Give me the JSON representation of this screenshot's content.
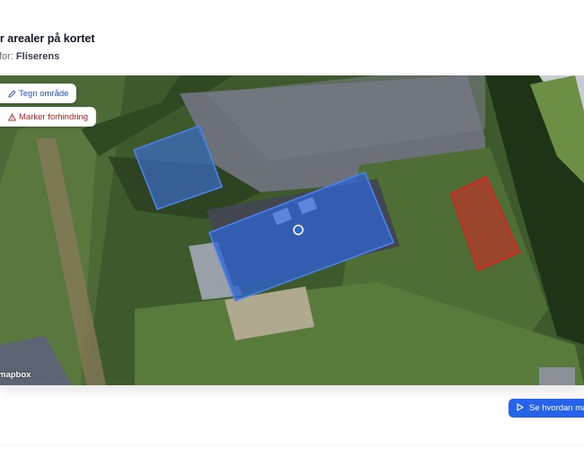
{
  "header": {
    "title": "ker arealer på kortet",
    "subtitle_prefix": "her for:",
    "service_name": "Fliserens"
  },
  "map": {
    "draw_area_label": "Tegn område",
    "mark_obstacle_label": "Marker forhindring",
    "attribution": "mapbox",
    "area_color": "#3b6fd6",
    "obstacle_color": "#dc2626"
  },
  "footer": {
    "video_button_label": "Se hvordan man"
  },
  "icons": {
    "draw": "pencil-icon",
    "obstacle": "warning-triangle-icon",
    "play": "play-icon"
  }
}
